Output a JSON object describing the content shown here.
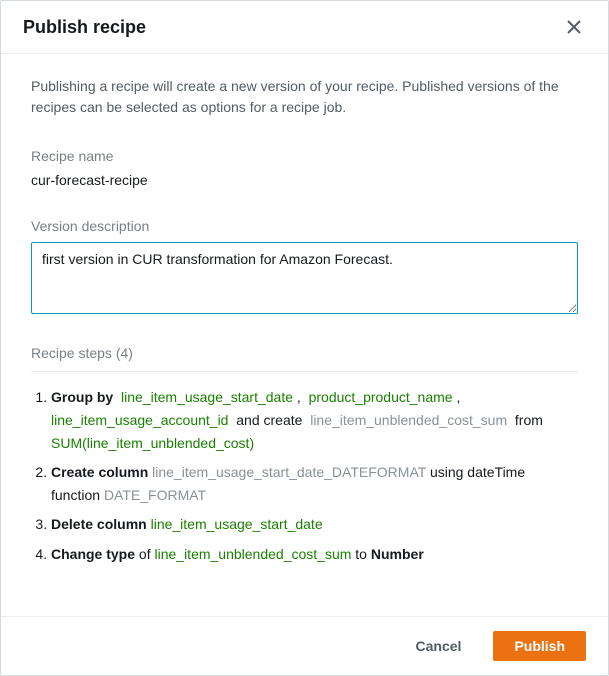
{
  "header": {
    "title": "Publish recipe"
  },
  "intro": "Publishing a recipe will create a new version of your recipe. Published versions of the recipes can be selected as options for a recipe job.",
  "recipeName": {
    "label": "Recipe name",
    "value": "cur-forecast-recipe"
  },
  "versionDescription": {
    "label": "Version description",
    "value": "first version in CUR transformation for Amazon Forecast."
  },
  "steps": {
    "header": "Recipe steps (4)",
    "items": [
      {
        "lead": "Group by",
        "tokens": [
          "line_item_usage_start_date",
          "product_product_name",
          "line_item_usage_account_id"
        ],
        "mid": "and create",
        "createdCol": "line_item_unblended_cost_sum",
        "from": "from",
        "agg": "SUM(line_item_unblended_cost)"
      },
      {
        "lead": "Create column",
        "col": "line_item_usage_start_date_DATEFORMAT",
        "mid": "using dateTime function",
        "fn": "DATE_FORMAT"
      },
      {
        "lead": "Delete column",
        "col": "line_item_usage_start_date"
      },
      {
        "lead": "Change type",
        "of": "of",
        "col": "line_item_unblended_cost_sum",
        "to": "to",
        "type": "Number"
      }
    ]
  },
  "footer": {
    "cancel": "Cancel",
    "publish": "Publish"
  }
}
